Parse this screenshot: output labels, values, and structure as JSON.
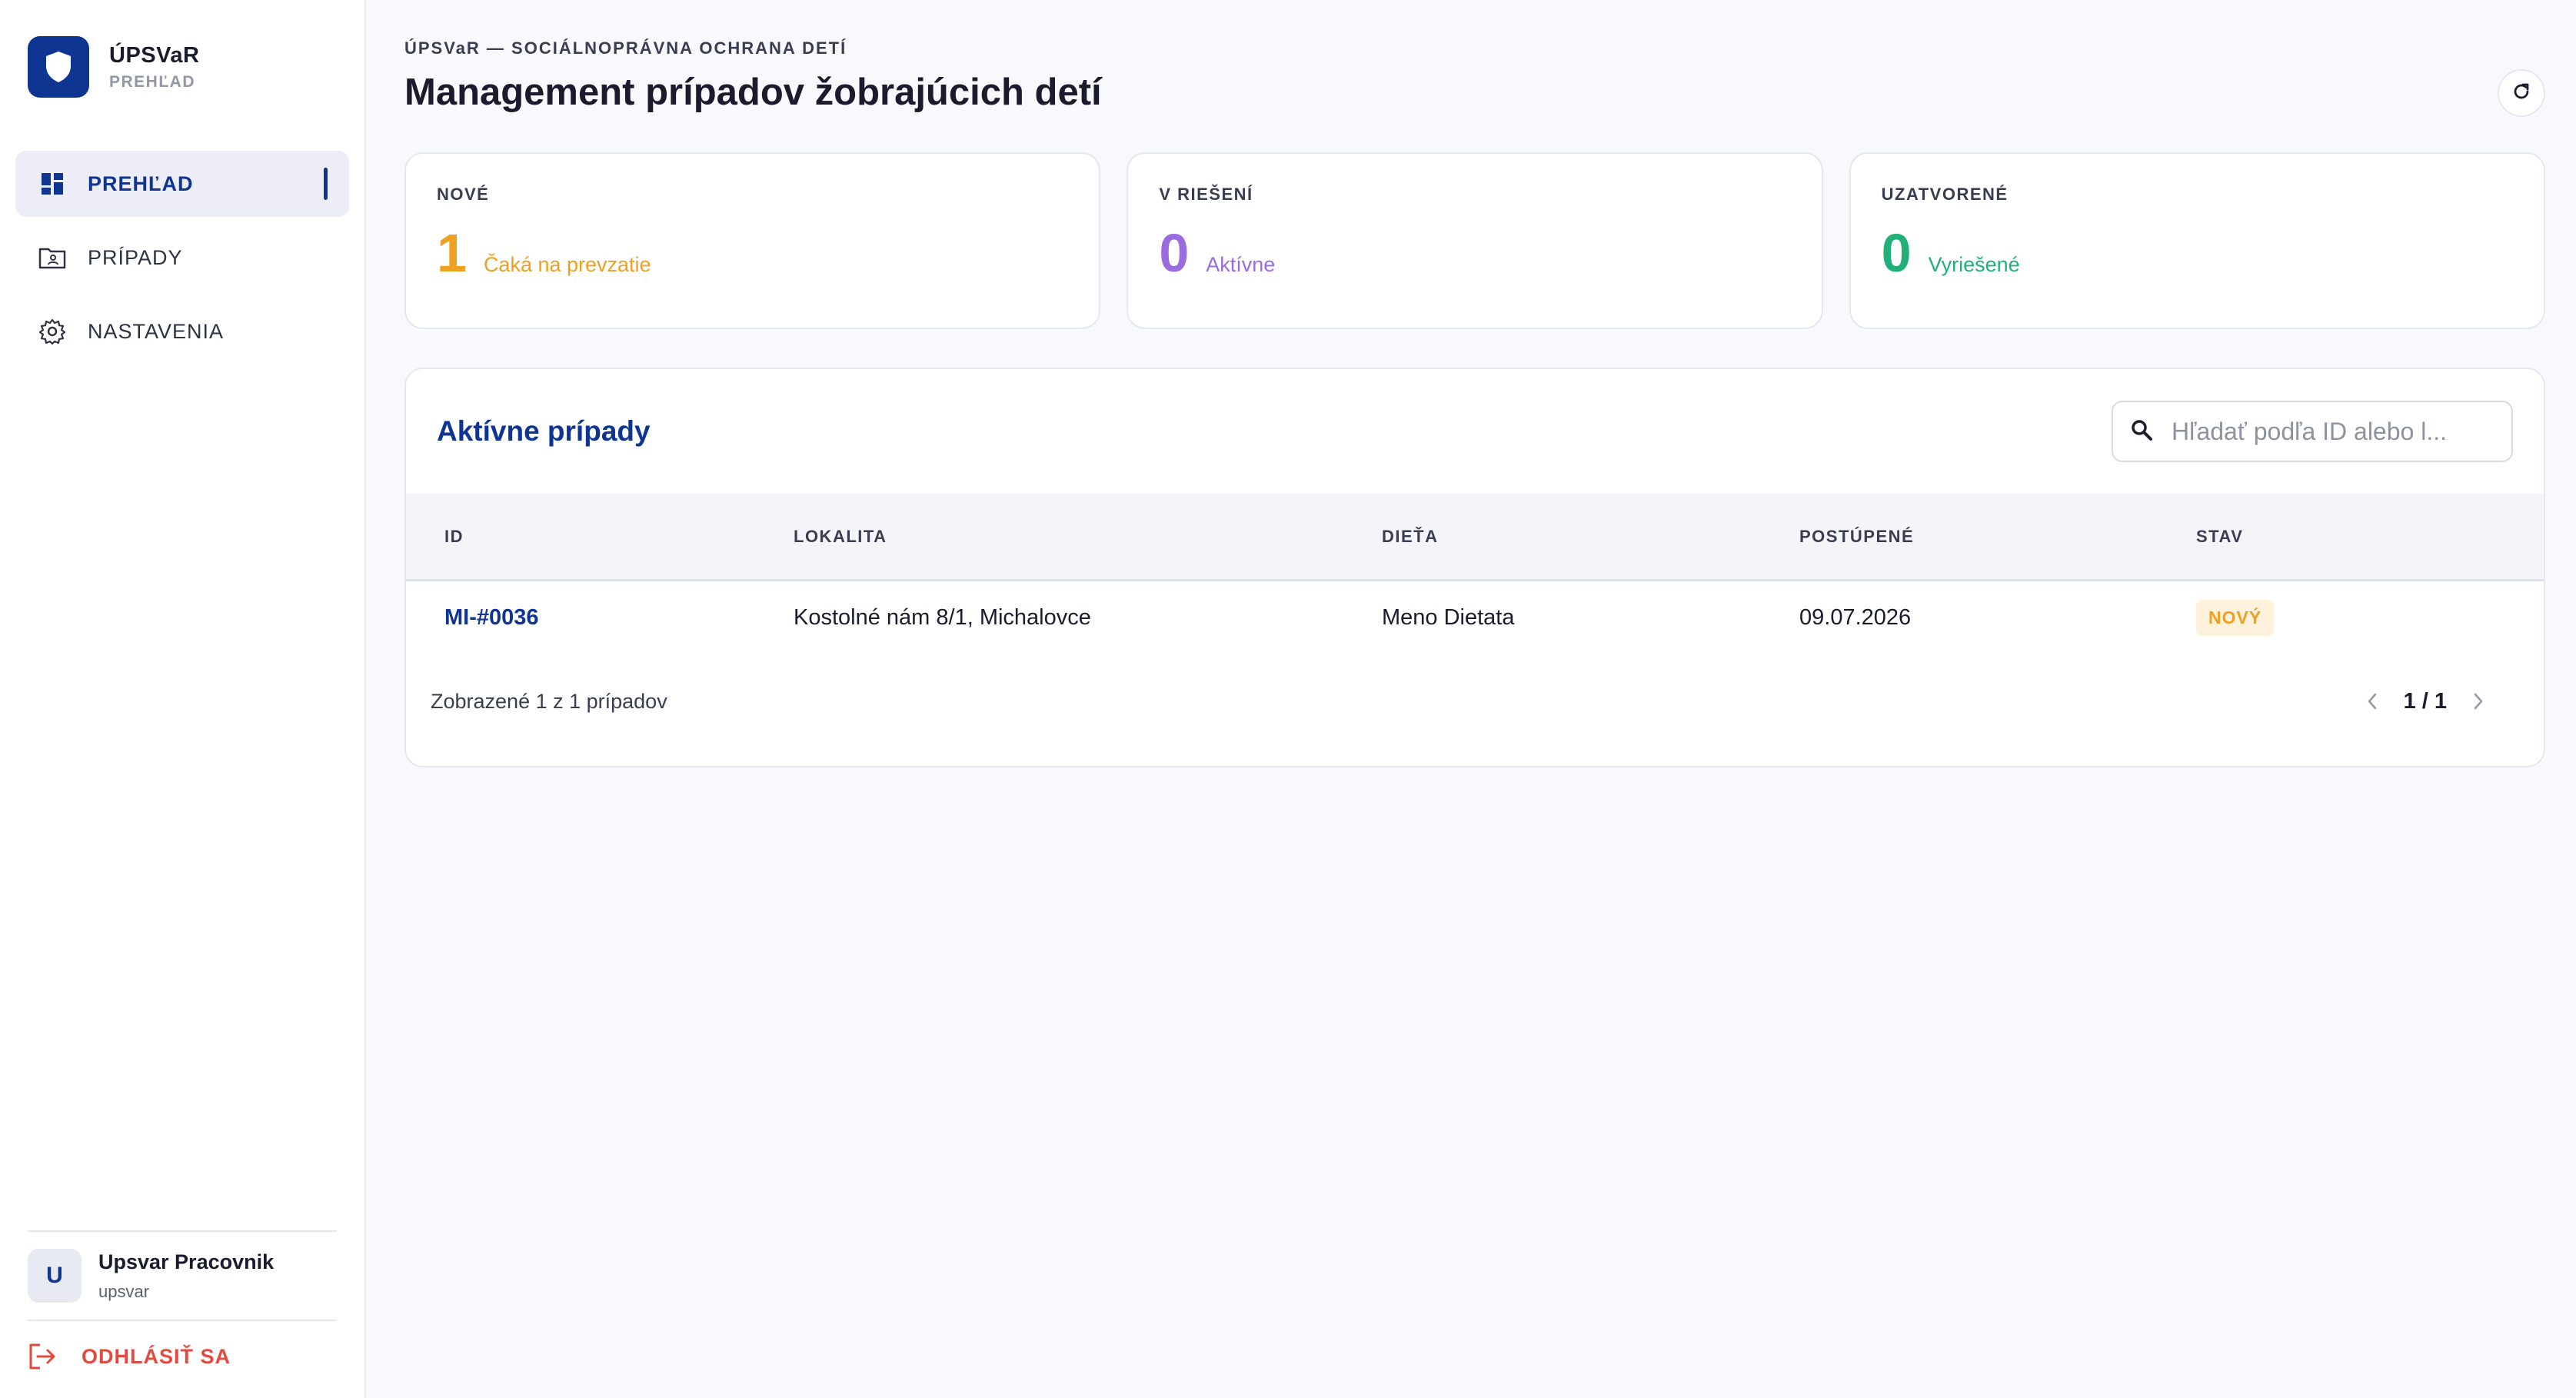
{
  "brand": {
    "title": "ÚPSVaR",
    "subtitle": "PREHĽAD",
    "logo_icon": "shield-icon"
  },
  "nav": {
    "items": [
      {
        "label": "PREHĽAD",
        "icon": "dashboard-icon",
        "active": true
      },
      {
        "label": "PRÍPADY",
        "icon": "folder-icon",
        "active": false
      },
      {
        "label": "NASTAVENIA",
        "icon": "gear-icon",
        "active": false
      }
    ]
  },
  "user": {
    "initial": "U",
    "name": "Upsvar Pracovnik",
    "login": "upsvar"
  },
  "logout": {
    "label": "ODHLÁSIŤ SA"
  },
  "header": {
    "eyebrow": "ÚPSVaR — SOCIÁLNOPRÁVNA OCHRANA DETÍ",
    "title": "Management prípadov žobrajúcich detí"
  },
  "stats": [
    {
      "label": "NOVÉ",
      "value": "1",
      "desc": "Čaká na prevzatie",
      "color": "#f0a020"
    },
    {
      "label": "V RIEŠENÍ",
      "value": "0",
      "desc": "Aktívne",
      "color": "#9b6ce0"
    },
    {
      "label": "UZATVORENÉ",
      "value": "0",
      "desc": "Vyriešené",
      "color": "#22b07a"
    }
  ],
  "cases": {
    "title": "Aktívne prípady",
    "search_placeholder": "Hľadať podľa ID alebo l...",
    "columns": [
      "ID",
      "LOKALITA",
      "DIEŤA",
      "POSTÚPENÉ",
      "STAV"
    ],
    "rows": [
      {
        "id": "MI-#0036",
        "location": "Kostolné nám 8/1, Michalovce",
        "child": "Meno Dietata",
        "referred": "09.07.2026",
        "status": "NOVÝ"
      }
    ],
    "footer": "Zobrazené 1 z 1 prípadov",
    "pager": "1 / 1"
  },
  "colors": {
    "brand": "#0d3591",
    "danger": "#e04a3f",
    "new": "#f0a020",
    "in_progress": "#9b6ce0",
    "closed": "#22b07a"
  }
}
